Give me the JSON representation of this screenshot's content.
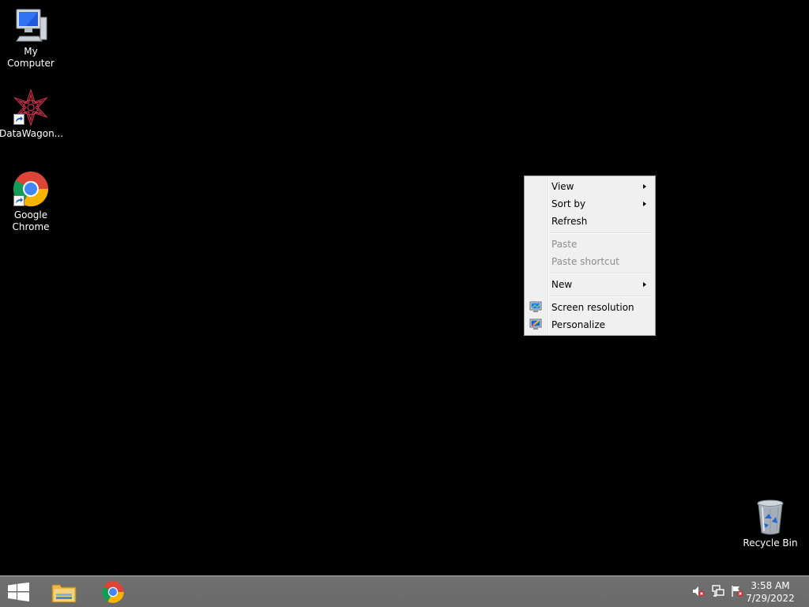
{
  "desktop": {
    "background_color": "#000000",
    "icons": [
      {
        "label": "My Computer",
        "icon": "my-computer-icon"
      },
      {
        "label": "DataWagon...",
        "icon": "datawagon-icon"
      },
      {
        "label": "Google Chrome",
        "icon": "chrome-icon"
      },
      {
        "label": "Recycle Bin",
        "icon": "recycle-bin-icon"
      }
    ]
  },
  "context_menu": {
    "items": [
      {
        "label": "View",
        "submenu": true,
        "disabled": false
      },
      {
        "label": "Sort by",
        "submenu": true,
        "disabled": false
      },
      {
        "label": "Refresh",
        "submenu": false,
        "disabled": false
      },
      {
        "label": "Paste",
        "submenu": false,
        "disabled": true
      },
      {
        "label": "Paste shortcut",
        "submenu": false,
        "disabled": true
      },
      {
        "label": "New",
        "submenu": true,
        "disabled": false
      },
      {
        "label": "Screen resolution",
        "submenu": false,
        "disabled": false,
        "icon": "screen-resolution-icon"
      },
      {
        "label": "Personalize",
        "submenu": false,
        "disabled": false,
        "icon": "personalize-icon"
      }
    ]
  },
  "taskbar": {
    "start_icon": "windows-logo-icon",
    "pinned": [
      {
        "icon": "file-explorer-icon"
      },
      {
        "icon": "chrome-icon"
      }
    ],
    "tray": {
      "icons": [
        "volume-muted-icon",
        "network-icon",
        "action-center-flag-icon"
      ],
      "time": "3:58 AM",
      "date": "7/29/2022"
    }
  }
}
